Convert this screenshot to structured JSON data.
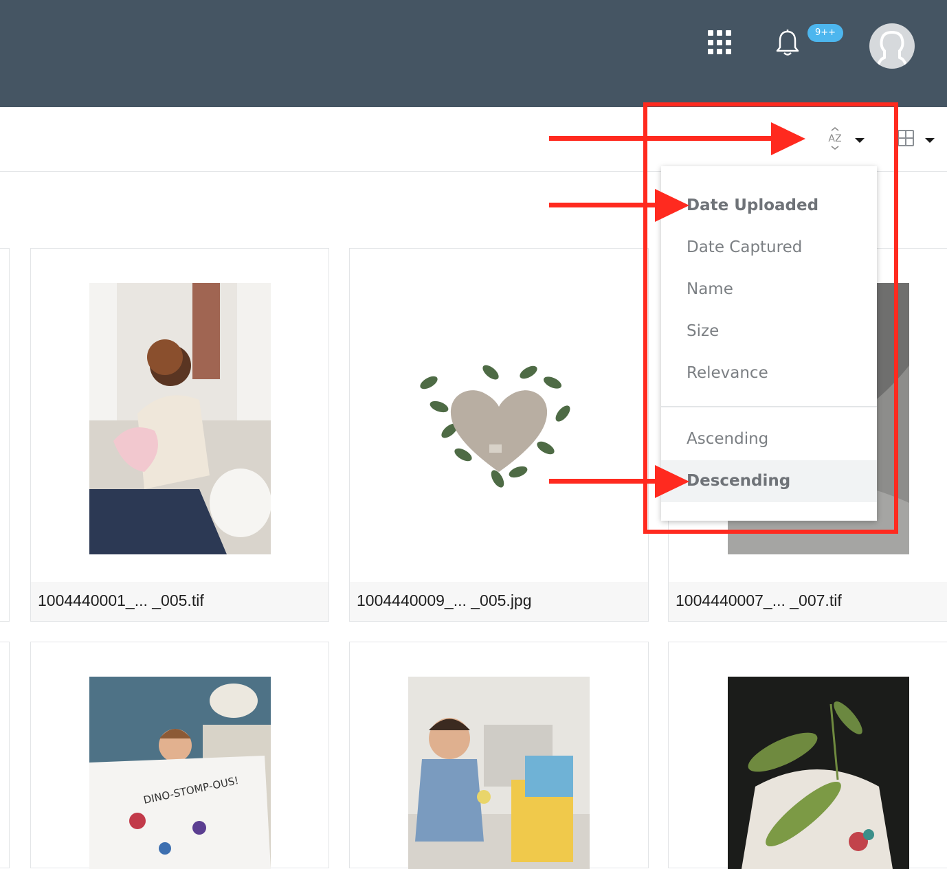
{
  "header": {
    "apps_icon": "apps-grid-icon",
    "bell_icon": "bell-icon",
    "notification_badge": "9++",
    "avatar_icon": "user-avatar-icon"
  },
  "toolbar": {
    "sort_icon_text": "AZ",
    "sort_icon": "sort-az-icon",
    "view_icon": "grid-view-icon"
  },
  "sort_menu": {
    "fields": [
      {
        "label": "Date Uploaded",
        "selected": true
      },
      {
        "label": "Date Captured",
        "selected": false
      },
      {
        "label": "Name",
        "selected": false
      },
      {
        "label": "Size",
        "selected": false
      },
      {
        "label": "Relevance",
        "selected": false
      }
    ],
    "order": [
      {
        "label": "Ascending",
        "selected": false
      },
      {
        "label": "Descending",
        "selected": true
      }
    ]
  },
  "assets": [
    {
      "filename": "1004440001_... _005.tif"
    },
    {
      "filename": "1004440009_... _005.jpg"
    },
    {
      "filename": "1004440007_... _007.tif"
    },
    {
      "filename": ""
    },
    {
      "filename": ""
    },
    {
      "filename": ""
    }
  ],
  "colors": {
    "header_bg": "#455563",
    "badge": "#4db6ee",
    "annotation_red": "#ff2a1f"
  }
}
